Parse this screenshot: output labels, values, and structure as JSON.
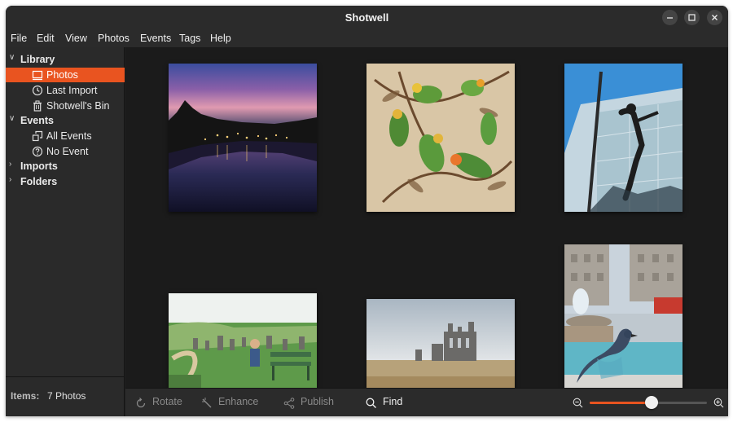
{
  "window": {
    "title": "Shotwell"
  },
  "menu": [
    "File",
    "Edit",
    "View",
    "Photos",
    "Events",
    "Tags",
    "Help"
  ],
  "sidebar": {
    "library": "Library",
    "photos": "Photos",
    "last_import": "Last Import",
    "bin": "Shotwell's Bin",
    "events": "Events",
    "all_events": "All Events",
    "no_event": "No Event",
    "imports": "Imports",
    "folders": "Folders",
    "selected": "Photos"
  },
  "footer": {
    "items_label": "Items:",
    "items_value": "7 Photos"
  },
  "toolbar": {
    "rotate": "Rotate",
    "enhance": "Enhance",
    "publish": "Publish",
    "find": "Find",
    "zoom_level": 0.53
  },
  "photos": [
    {
      "subject": "sunset river"
    },
    {
      "subject": "parrots illustration"
    },
    {
      "subject": "climbing wall"
    },
    {
      "subject": "graveyard bench"
    },
    {
      "subject": "abbey ruins"
    },
    {
      "subject": "square with pigeon"
    }
  ],
  "colors": {
    "accent": "#e95420"
  }
}
